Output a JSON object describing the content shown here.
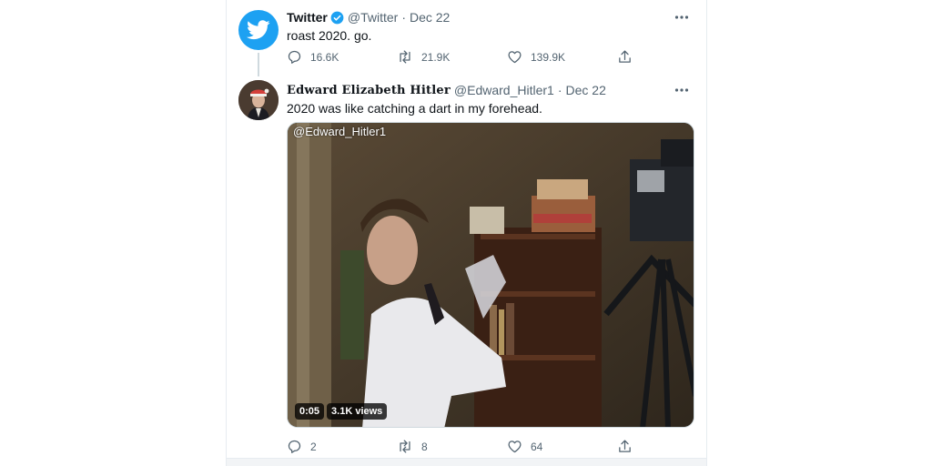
{
  "tweets": [
    {
      "name": "Twitter",
      "verified": true,
      "handle": "@Twitter",
      "separator": "·",
      "date": "Dec 22",
      "text": "roast 2020. go.",
      "avatar_icon": "twitter-bird-icon",
      "stats": {
        "replies": "16.6K",
        "retweets": "21.9K",
        "likes": "139.9K"
      }
    },
    {
      "name": "𝐄𝐝𝐰𝐚𝐫𝐝 𝐄𝐥𝐢𝐳𝐚𝐛𝐞𝐭𝐡 𝐇𝐢𝐭𝐥𝐞𝐫",
      "handle": "@Edward_Hitler1",
      "separator": "·",
      "date": "Dec 22",
      "text": "2020 was like catching a dart in my forehead.",
      "media": {
        "watermark": "@Edward_Hitler1",
        "duration": "0:05",
        "views": "3.1K views"
      },
      "stats": {
        "replies": "2",
        "retweets": "8",
        "likes": "64"
      }
    }
  ],
  "colors": {
    "brand_blue": "#1da1f2",
    "text_primary": "#0f1419",
    "text_secondary": "#536471",
    "border": "#e6ecf0"
  },
  "icons": [
    "reply-icon",
    "retweet-icon",
    "like-icon",
    "share-icon",
    "more-icon",
    "verified-badge-icon"
  ]
}
